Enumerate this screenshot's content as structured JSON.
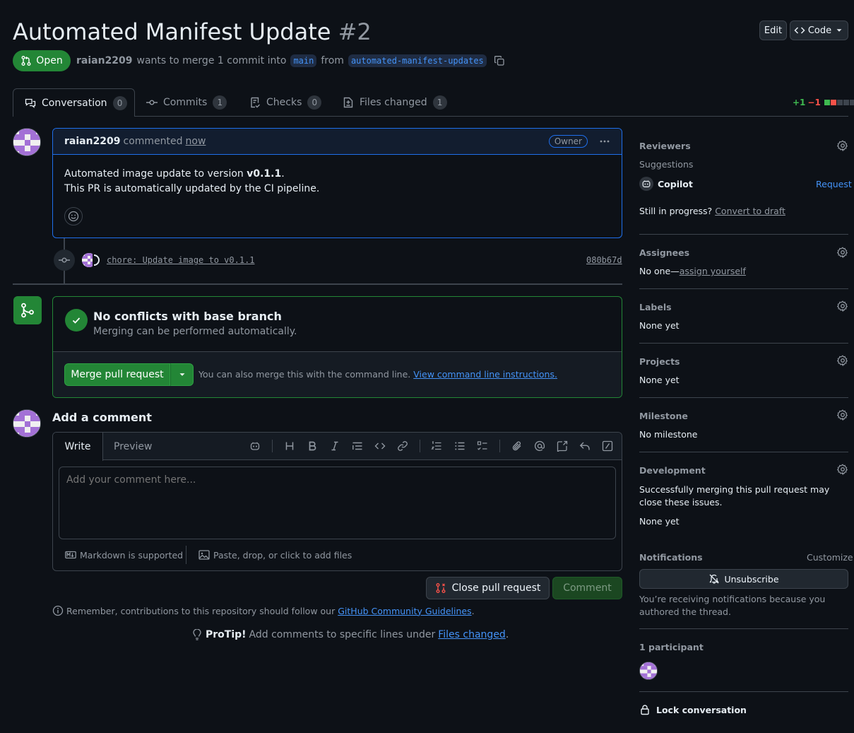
{
  "header": {
    "title": "Automated Manifest Update",
    "number": "#2",
    "edit_label": "Edit",
    "code_label": "Code",
    "status": "Open",
    "author": "raian2209",
    "merge_text_1": "wants to merge 1 commit into",
    "base_branch": "main",
    "merge_text_2": "from",
    "head_branch": "automated-manifest-updates"
  },
  "tabs": [
    {
      "label": "Conversation",
      "count": "0",
      "icon": "comment-discussion-icon"
    },
    {
      "label": "Commits",
      "count": "1",
      "icon": "git-commit-icon"
    },
    {
      "label": "Checks",
      "count": "0",
      "icon": "checklist-icon"
    },
    {
      "label": "Files changed",
      "count": "1",
      "icon": "file-diff-icon"
    }
  ],
  "diffstat": {
    "additions": "+1",
    "deletions": "−1"
  },
  "comment": {
    "author": "raian2209",
    "action": "commented",
    "time": "now",
    "badge": "Owner",
    "line1_prefix": "Automated image update to version",
    "line1_version": "v0.1.1",
    "line1_suffix": ".",
    "line2": "This PR is automatically updated by the CI pipeline."
  },
  "commit": {
    "message": "chore: Update image to v0.1.1",
    "sha": "080b67d"
  },
  "merge": {
    "title": "No conflicts with base branch",
    "subtitle": "Merging can be performed automatically.",
    "button": "Merge pull request",
    "hint": "You can also merge this with the command line.",
    "hint_link": "View command line instructions."
  },
  "add_comment": {
    "heading": "Add a comment",
    "tab_write": "Write",
    "tab_preview": "Preview",
    "placeholder": "Add your comment here...",
    "markdown_note": "Markdown is supported",
    "attach_note": "Paste, drop, or click to add files",
    "close_button": "Close pull request",
    "comment_button": "Comment"
  },
  "footer": {
    "guidelines_prefix": "Remember, contributions to this repository should follow our",
    "guidelines_link": "GitHub Community Guidelines",
    "guidelines_suffix": ".",
    "protip_label": "ProTip!",
    "protip_text": "Add comments to specific lines under",
    "protip_link": "Files changed",
    "protip_suffix": "."
  },
  "sidebar": {
    "reviewers_label": "Reviewers",
    "suggestions_label": "Suggestions",
    "copilot_label": "Copilot",
    "request_label": "Request",
    "draft_prefix": "Still in progress?",
    "draft_link": "Convert to draft",
    "assignees_label": "Assignees",
    "assignees_prefix": "No one—",
    "assignees_link": "assign yourself",
    "labels_label": "Labels",
    "labels_value": "None yet",
    "projects_label": "Projects",
    "projects_value": "None yet",
    "milestone_label": "Milestone",
    "milestone_value": "No milestone",
    "development_label": "Development",
    "development_text": "Successfully merging this pull request may close these issues.",
    "development_value": "None yet",
    "notifications_label": "Notifications",
    "customize_label": "Customize",
    "unsubscribe_label": "Unsubscribe",
    "notifications_reason": "You’re receiving notifications because you authored the thread.",
    "participants_label": "1 participant",
    "lock_label": "Lock conversation"
  },
  "colors": {
    "background": "#0d1117",
    "open_green": "#238636",
    "link_blue": "#4493f8",
    "danger_red": "#f85149",
    "border": "#3d444d"
  }
}
